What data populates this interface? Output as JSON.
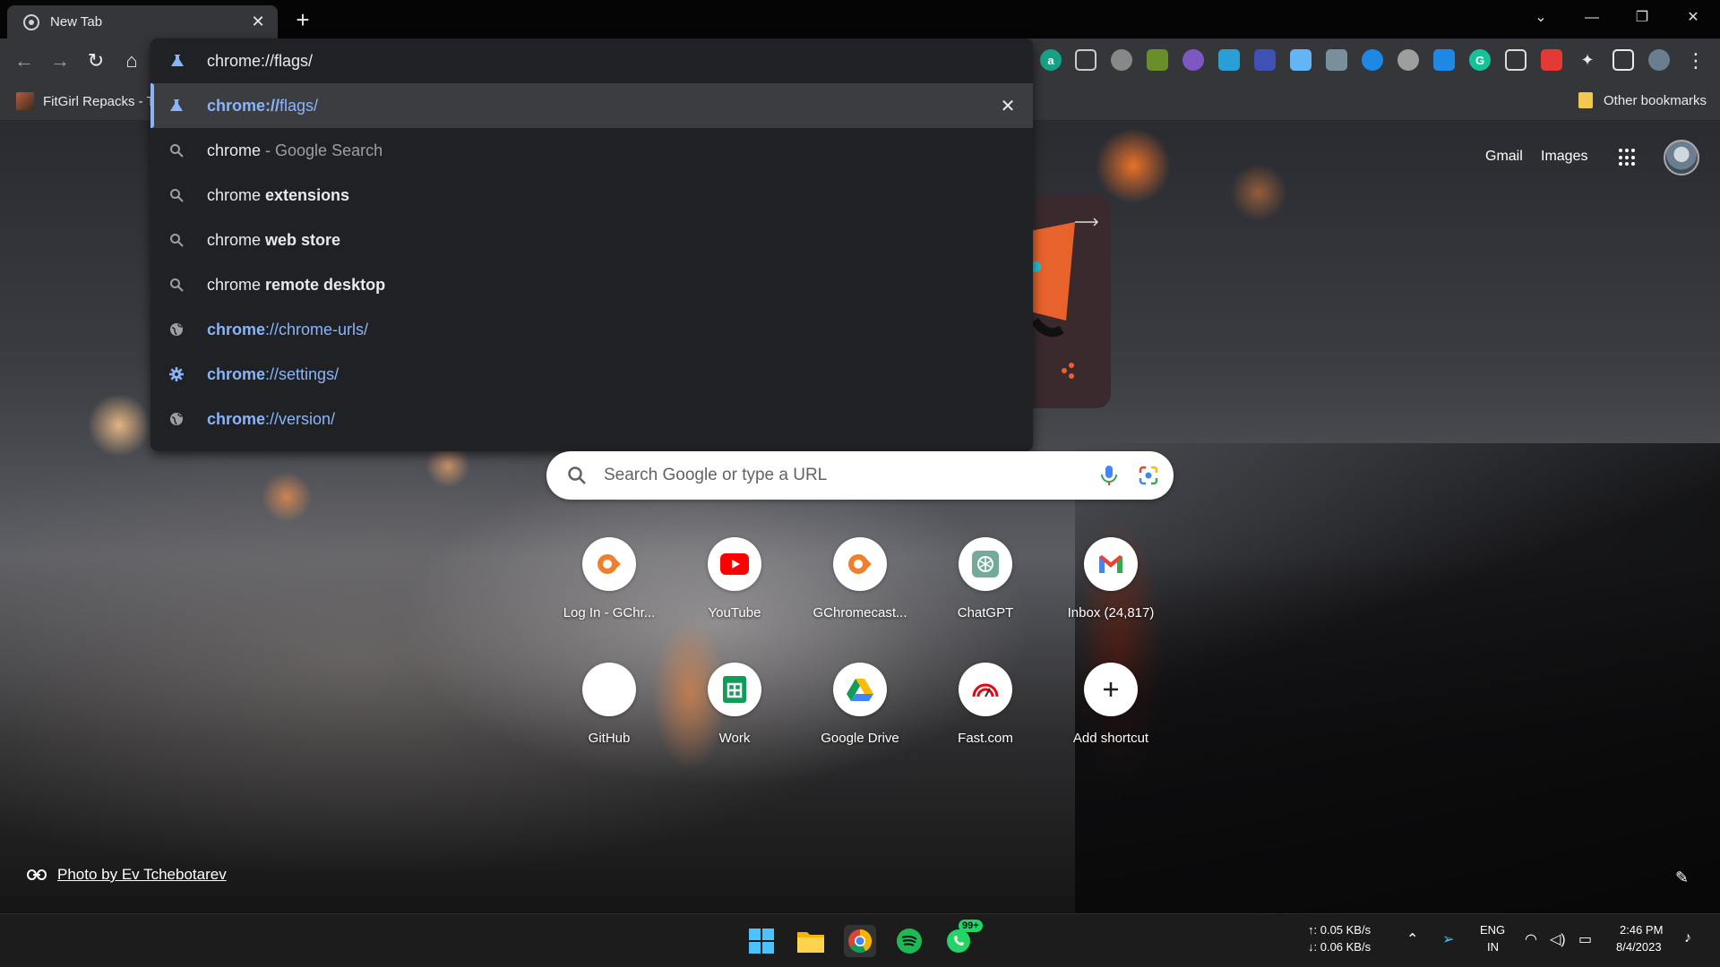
{
  "tab": {
    "title": "New Tab",
    "close_glyph": "✕"
  },
  "newtab_glyph": "+",
  "window": {
    "min": "—",
    "restore": "❐",
    "close": "✕",
    "tabsearch": "⌄"
  },
  "toolbar": {
    "back": "←",
    "forward": "→",
    "reload": "↻",
    "home": "⌂",
    "menu": "⋮"
  },
  "bookmarks": {
    "left": "FitGirl Repacks - Tl",
    "right": "Other bookmarks"
  },
  "omnibox": {
    "value": "chrome://flags/",
    "suggestions": [
      {
        "text_bold": "chrome://",
        "text_rest": "flags/",
        "type": "lab",
        "link": true,
        "selected": true
      },
      {
        "text_bold": "chrome",
        "text_rest": " - Google Search",
        "type": "search"
      },
      {
        "text_bold": "chrome ",
        "text_rest": "extensions",
        "type": "search"
      },
      {
        "text_bold": "chrome ",
        "text_rest": "web store",
        "type": "search"
      },
      {
        "text_bold": "chrome ",
        "text_rest": "remote desktop",
        "type": "search"
      },
      {
        "text_bold": "chrome",
        "text_rest": "://chrome-urls/",
        "type": "globe",
        "link": true
      },
      {
        "text_bold": "chrome",
        "text_rest": "://settings/",
        "type": "gear",
        "link": true
      },
      {
        "text_bold": "chrome",
        "text_rest": "://version/",
        "type": "globe",
        "link": true
      }
    ],
    "remove_glyph": "✕"
  },
  "header": {
    "gmail": "Gmail",
    "images": "Images"
  },
  "search": {
    "placeholder": "Search Google or type a URL"
  },
  "shortcuts": [
    {
      "label": "Log In - GChr...",
      "icon": "gchromecast-icon"
    },
    {
      "label": "YouTube",
      "icon": "youtube-icon"
    },
    {
      "label": "GChromecast...",
      "icon": "gchromecast-icon"
    },
    {
      "label": "ChatGPT",
      "icon": "chatgpt-icon"
    },
    {
      "label": "Inbox (24,817)",
      "icon": "gmail-icon"
    },
    {
      "label": "GitHub",
      "icon": "github-icon"
    },
    {
      "label": "Work",
      "icon": "sheets-icon"
    },
    {
      "label": "Google Drive",
      "icon": "drive-icon"
    },
    {
      "label": "Fast.com",
      "icon": "fast-icon"
    },
    {
      "label": "Add shortcut",
      "icon": "plus-icon"
    }
  ],
  "credit": {
    "text": "Photo by Ev Tchebotarev"
  },
  "taskbar": {
    "whatsapp_badge": "99+",
    "net_up": "↑: 0.05 KB/s",
    "net_down": "↓: 0.06 KB/s",
    "lang1": "ENG",
    "lang2": "IN",
    "time": "2:46 PM",
    "date": "8/4/2023"
  },
  "colors": {
    "accent": "#8ab4f8",
    "omnibox_bg": "#202124",
    "toolbar_bg": "#35363a"
  }
}
